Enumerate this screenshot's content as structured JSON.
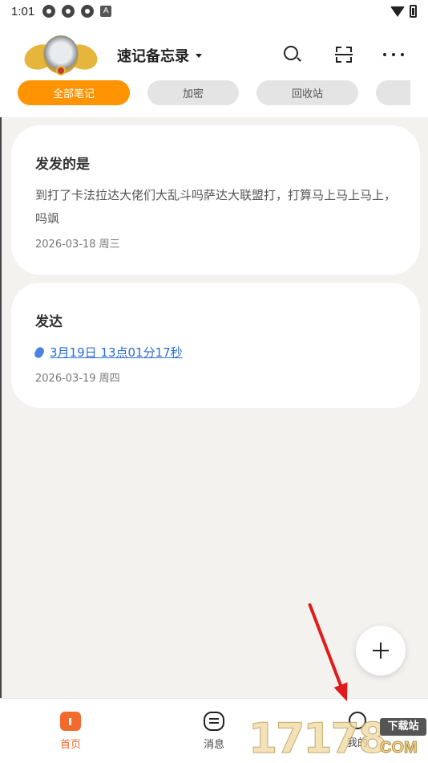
{
  "status_bar": {
    "time": "1:01",
    "a_badge": "A"
  },
  "app": {
    "title": "速记备忘录"
  },
  "tabs": [
    {
      "label": "全部笔记",
      "active": true
    },
    {
      "label": "加密",
      "active": false
    },
    {
      "label": "回收站",
      "active": false
    },
    {
      "label": "",
      "active": false
    }
  ],
  "notes": [
    {
      "title": "发发的是",
      "body": "到打了卡法拉达大佬们大乱斗吗萨达大联盟打，打算马上马上马上， 吗飒",
      "date": "2026-03-18 周三"
    },
    {
      "title": "发达",
      "body": "3月19日 13点01分17秒",
      "date": "2026-03-19 周四"
    }
  ],
  "fab": {
    "icon": "plus-icon"
  },
  "bottom_nav": [
    {
      "label": "首页",
      "icon": "home-icon",
      "active": true
    },
    {
      "label": "消息",
      "icon": "message-icon",
      "active": false
    },
    {
      "label": "我的",
      "icon": "profile-icon",
      "active": false
    }
  ],
  "watermark": {
    "number": "17178",
    "label": "下载站",
    "domain": "COM"
  },
  "colors": {
    "accent": "#ff9300",
    "nav_active": "#f26a2e",
    "link": "#2a6cd6",
    "background": "#f4f2ee",
    "arrow": "#e01b1b"
  }
}
